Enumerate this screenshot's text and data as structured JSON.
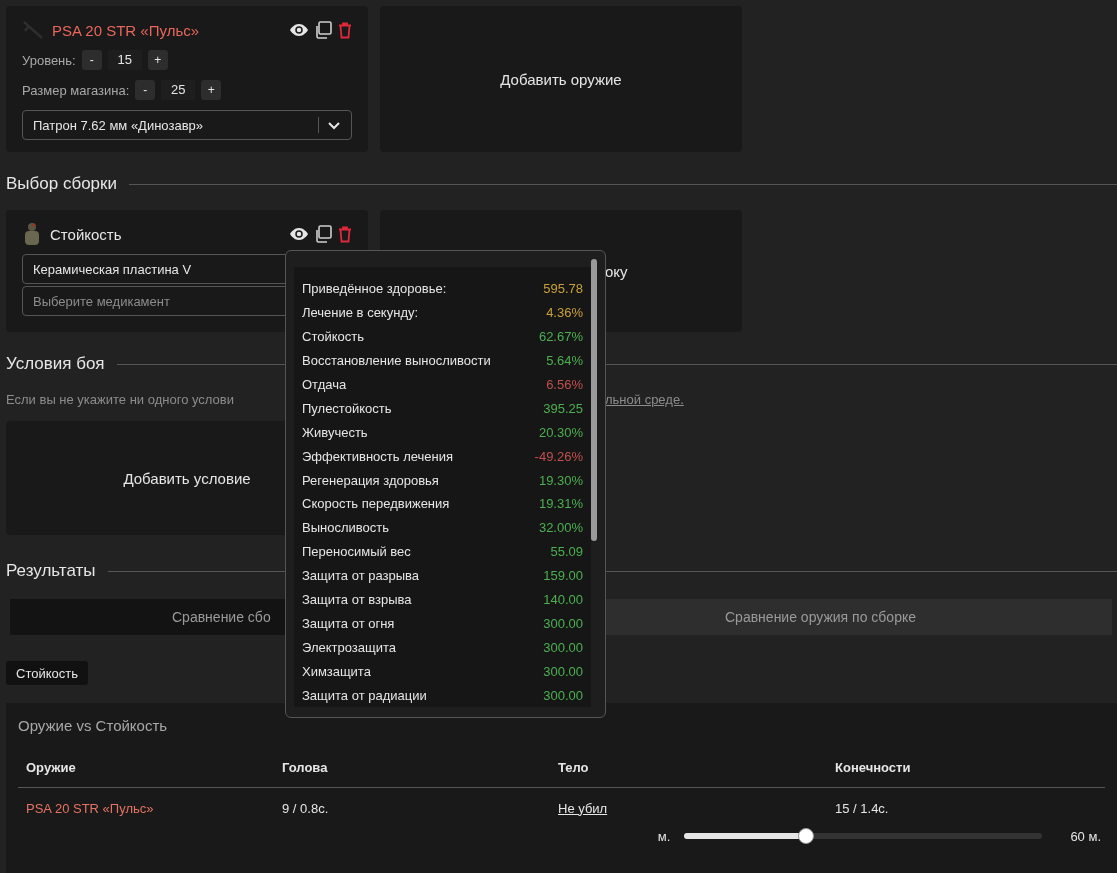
{
  "weapons": {
    "cards": [
      {
        "name": "PSA 20 STR «Пульс»",
        "steppers": [
          {
            "label": "Уровень:",
            "minus": "-",
            "value": "15",
            "plus": "+"
          },
          {
            "label": "Размер магазина:",
            "minus": "-",
            "value": "25",
            "plus": "+"
          }
        ],
        "ammo": "Патрон 7.62 мм «Динозавр»"
      }
    ],
    "add_card": "Добавить оружие"
  },
  "builds": {
    "title": "Выбор сборки",
    "cards": [
      {
        "name": "Стойкость",
        "armor": "Керамическая пластина V",
        "medkit_placeholder": "Выберите медикамент"
      }
    ],
    "add_card": "оку"
  },
  "conditions": {
    "title": "Условия боя",
    "note": "Если вы не укажите ни одного услови",
    "note_link": "льной среде.",
    "add_card": "Добавить условие"
  },
  "results": {
    "title": "Результаты",
    "tabs": [
      {
        "label": "Сравнение сбо",
        "selected": false
      },
      {
        "label": "Сравнение оружия по сборке",
        "selected": true
      }
    ],
    "chips": [
      {
        "label": "Стойкость",
        "selected": true
      }
    ],
    "table": {
      "title": "Оружие vs Стойкость",
      "columns": [
        "Оружие",
        "Голова",
        "Тело",
        "Конечности"
      ],
      "rows": [
        {
          "weapon": "PSA 20 STR «Пульс»",
          "head": "9 / 0.8с.",
          "body": "Не убил",
          "limbs": "15 / 1.4с."
        }
      ]
    },
    "range": {
      "min_label": "м.",
      "level": 0.34,
      "max_label": "60 м."
    }
  },
  "tooltip": {
    "stats": [
      {
        "label": "Приведённое здоровье:",
        "value": "595.78",
        "color": "#c9a03a"
      },
      {
        "label": "Лечение в секунду:",
        "value": "4.36%",
        "color": "#c9a03a"
      },
      {
        "label": "Стойкость",
        "value": "62.67%",
        "color": "#4caf50"
      },
      {
        "label": "Восстановление выносливости",
        "value": "5.64%",
        "color": "#4caf50"
      },
      {
        "label": "Отдача",
        "value": "6.56%",
        "color": "#c0504d"
      },
      {
        "label": "Пулестойкость",
        "value": "395.25",
        "color": "#4caf50"
      },
      {
        "label": "Живучесть",
        "value": "20.30%",
        "color": "#4caf50"
      },
      {
        "label": "Эффективность лечения",
        "value": "-49.26%",
        "color": "#c0504d"
      },
      {
        "label": "Регенерация здоровья",
        "value": "19.30%",
        "color": "#4caf50"
      },
      {
        "label": "Скорость передвижения",
        "value": "19.31%",
        "color": "#4caf50"
      },
      {
        "label": "Выносливость",
        "value": "32.00%",
        "color": "#4caf50"
      },
      {
        "label": "Переносимый вес",
        "value": "55.09",
        "color": "#4caf50"
      },
      {
        "label": "Защита от разрыва",
        "value": "159.00",
        "color": "#4caf50"
      },
      {
        "label": "Защита от взрыва",
        "value": "140.00",
        "color": "#4caf50"
      },
      {
        "label": "Защита от огня",
        "value": "300.00",
        "color": "#4caf50"
      },
      {
        "label": "Электрозащита",
        "value": "300.00",
        "color": "#4caf50"
      },
      {
        "label": "Химзащита",
        "value": "300.00",
        "color": "#4caf50"
      },
      {
        "label": "Защита от радиации",
        "value": "300.00",
        "color": "#4caf50"
      }
    ]
  }
}
